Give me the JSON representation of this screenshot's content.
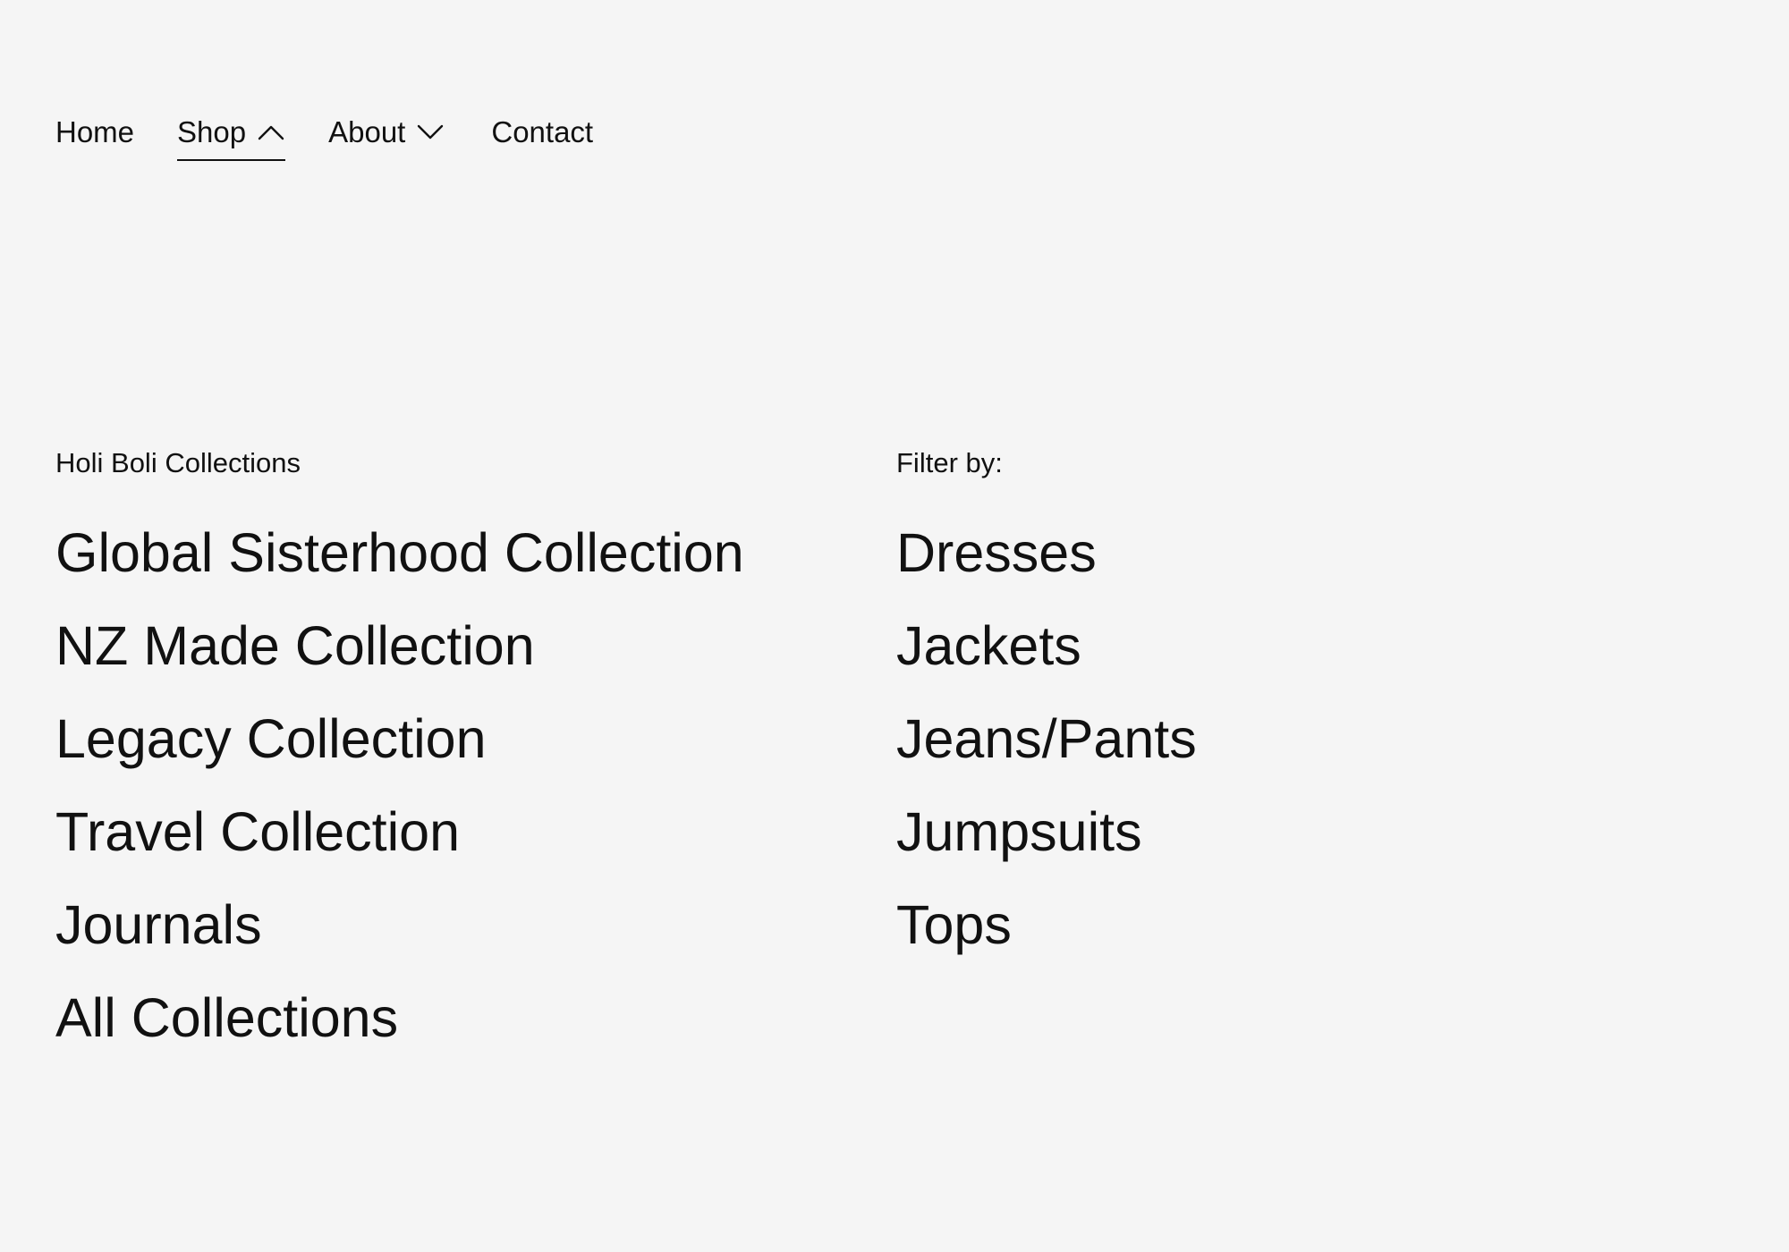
{
  "nav": {
    "items": [
      {
        "label": "Home"
      },
      {
        "label": "Shop"
      },
      {
        "label": "About"
      },
      {
        "label": "Contact"
      }
    ]
  },
  "collections": {
    "heading": "Holi Boli Collections",
    "items": [
      {
        "label": "Global Sisterhood Collection"
      },
      {
        "label": "NZ Made Collection"
      },
      {
        "label": "Legacy Collection"
      },
      {
        "label": "Travel Collection"
      },
      {
        "label": "Journals"
      },
      {
        "label": "All Collections"
      }
    ]
  },
  "filter": {
    "heading": "Filter by:",
    "items": [
      {
        "label": "Dresses"
      },
      {
        "label": "Jackets"
      },
      {
        "label": "Jeans/Pants"
      },
      {
        "label": "Jumpsuits"
      },
      {
        "label": "Tops"
      }
    ]
  },
  "icons": {
    "shop_chevron": "chevron-up-icon",
    "about_chevron": "chevron-down-icon"
  },
  "colors": {
    "background": "#f5f5f5",
    "text": "#111111"
  }
}
